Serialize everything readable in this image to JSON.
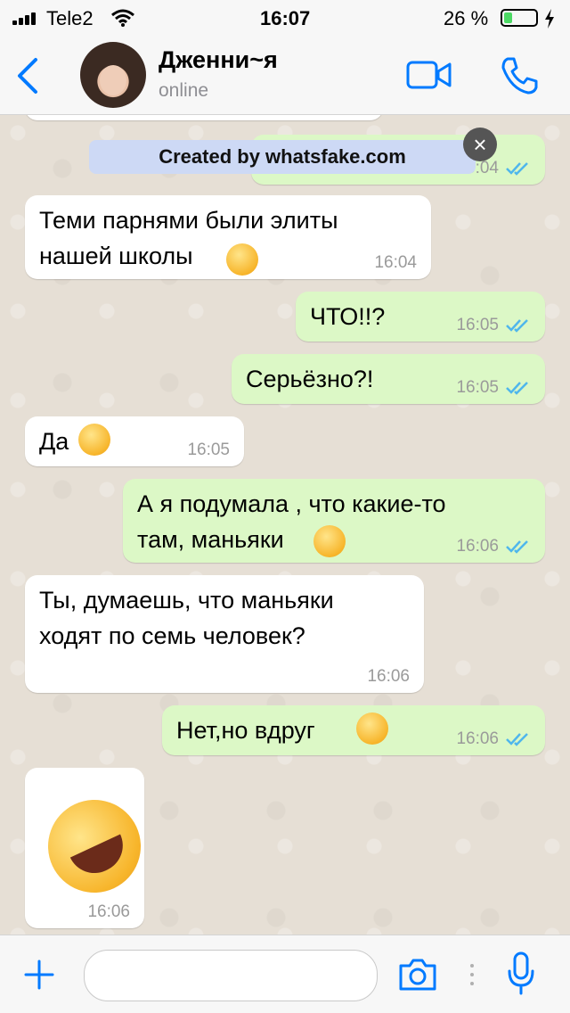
{
  "status_bar": {
    "carrier": "Tele2",
    "time": "16:07",
    "battery_percent": "26 %",
    "battery_level": 0.26
  },
  "header": {
    "contact_name": "Дженни~я",
    "contact_status": "online"
  },
  "watermark": {
    "text": "Created by whatsfake.com"
  },
  "messages": [
    {
      "direction": "out",
      "text": "",
      "time": "16:04",
      "read": true
    },
    {
      "direction": "in",
      "text": "Теми парнями были элиты\nнашей школы",
      "emoji": "hushed-face",
      "time": "16:04"
    },
    {
      "direction": "out",
      "text": "ЧТО!!?",
      "time": "16:05",
      "read": true
    },
    {
      "direction": "out",
      "text": "Серьёзно?!",
      "time": "16:05",
      "read": true
    },
    {
      "direction": "in",
      "text": "Да",
      "emoji": "grinning-sweat",
      "time": "16:05"
    },
    {
      "direction": "out",
      "text": "А я подумала , что какие-то\nтам, маньяки",
      "emoji": "laughing-squint",
      "time": "16:06",
      "read": true
    },
    {
      "direction": "in",
      "text": "Ты, думаешь, что маньяки\nходят по семь человек?",
      "time": "16:06"
    },
    {
      "direction": "out",
      "text": "Нет,но вдруг ",
      "emoji": "tears-of-joy",
      "time": "16:06",
      "read": true
    },
    {
      "direction": "in",
      "text": "",
      "emoji": "rolling-on-floor-laughing",
      "time": "16:06"
    }
  ],
  "input_bar": {
    "placeholder": ""
  },
  "colors": {
    "accent": "#007aff",
    "outgoing_bubble": "#dcf8c6",
    "incoming_bubble": "#ffffff",
    "read_ticks": "#4fb6ec",
    "chat_background": "#e6dfd5"
  }
}
